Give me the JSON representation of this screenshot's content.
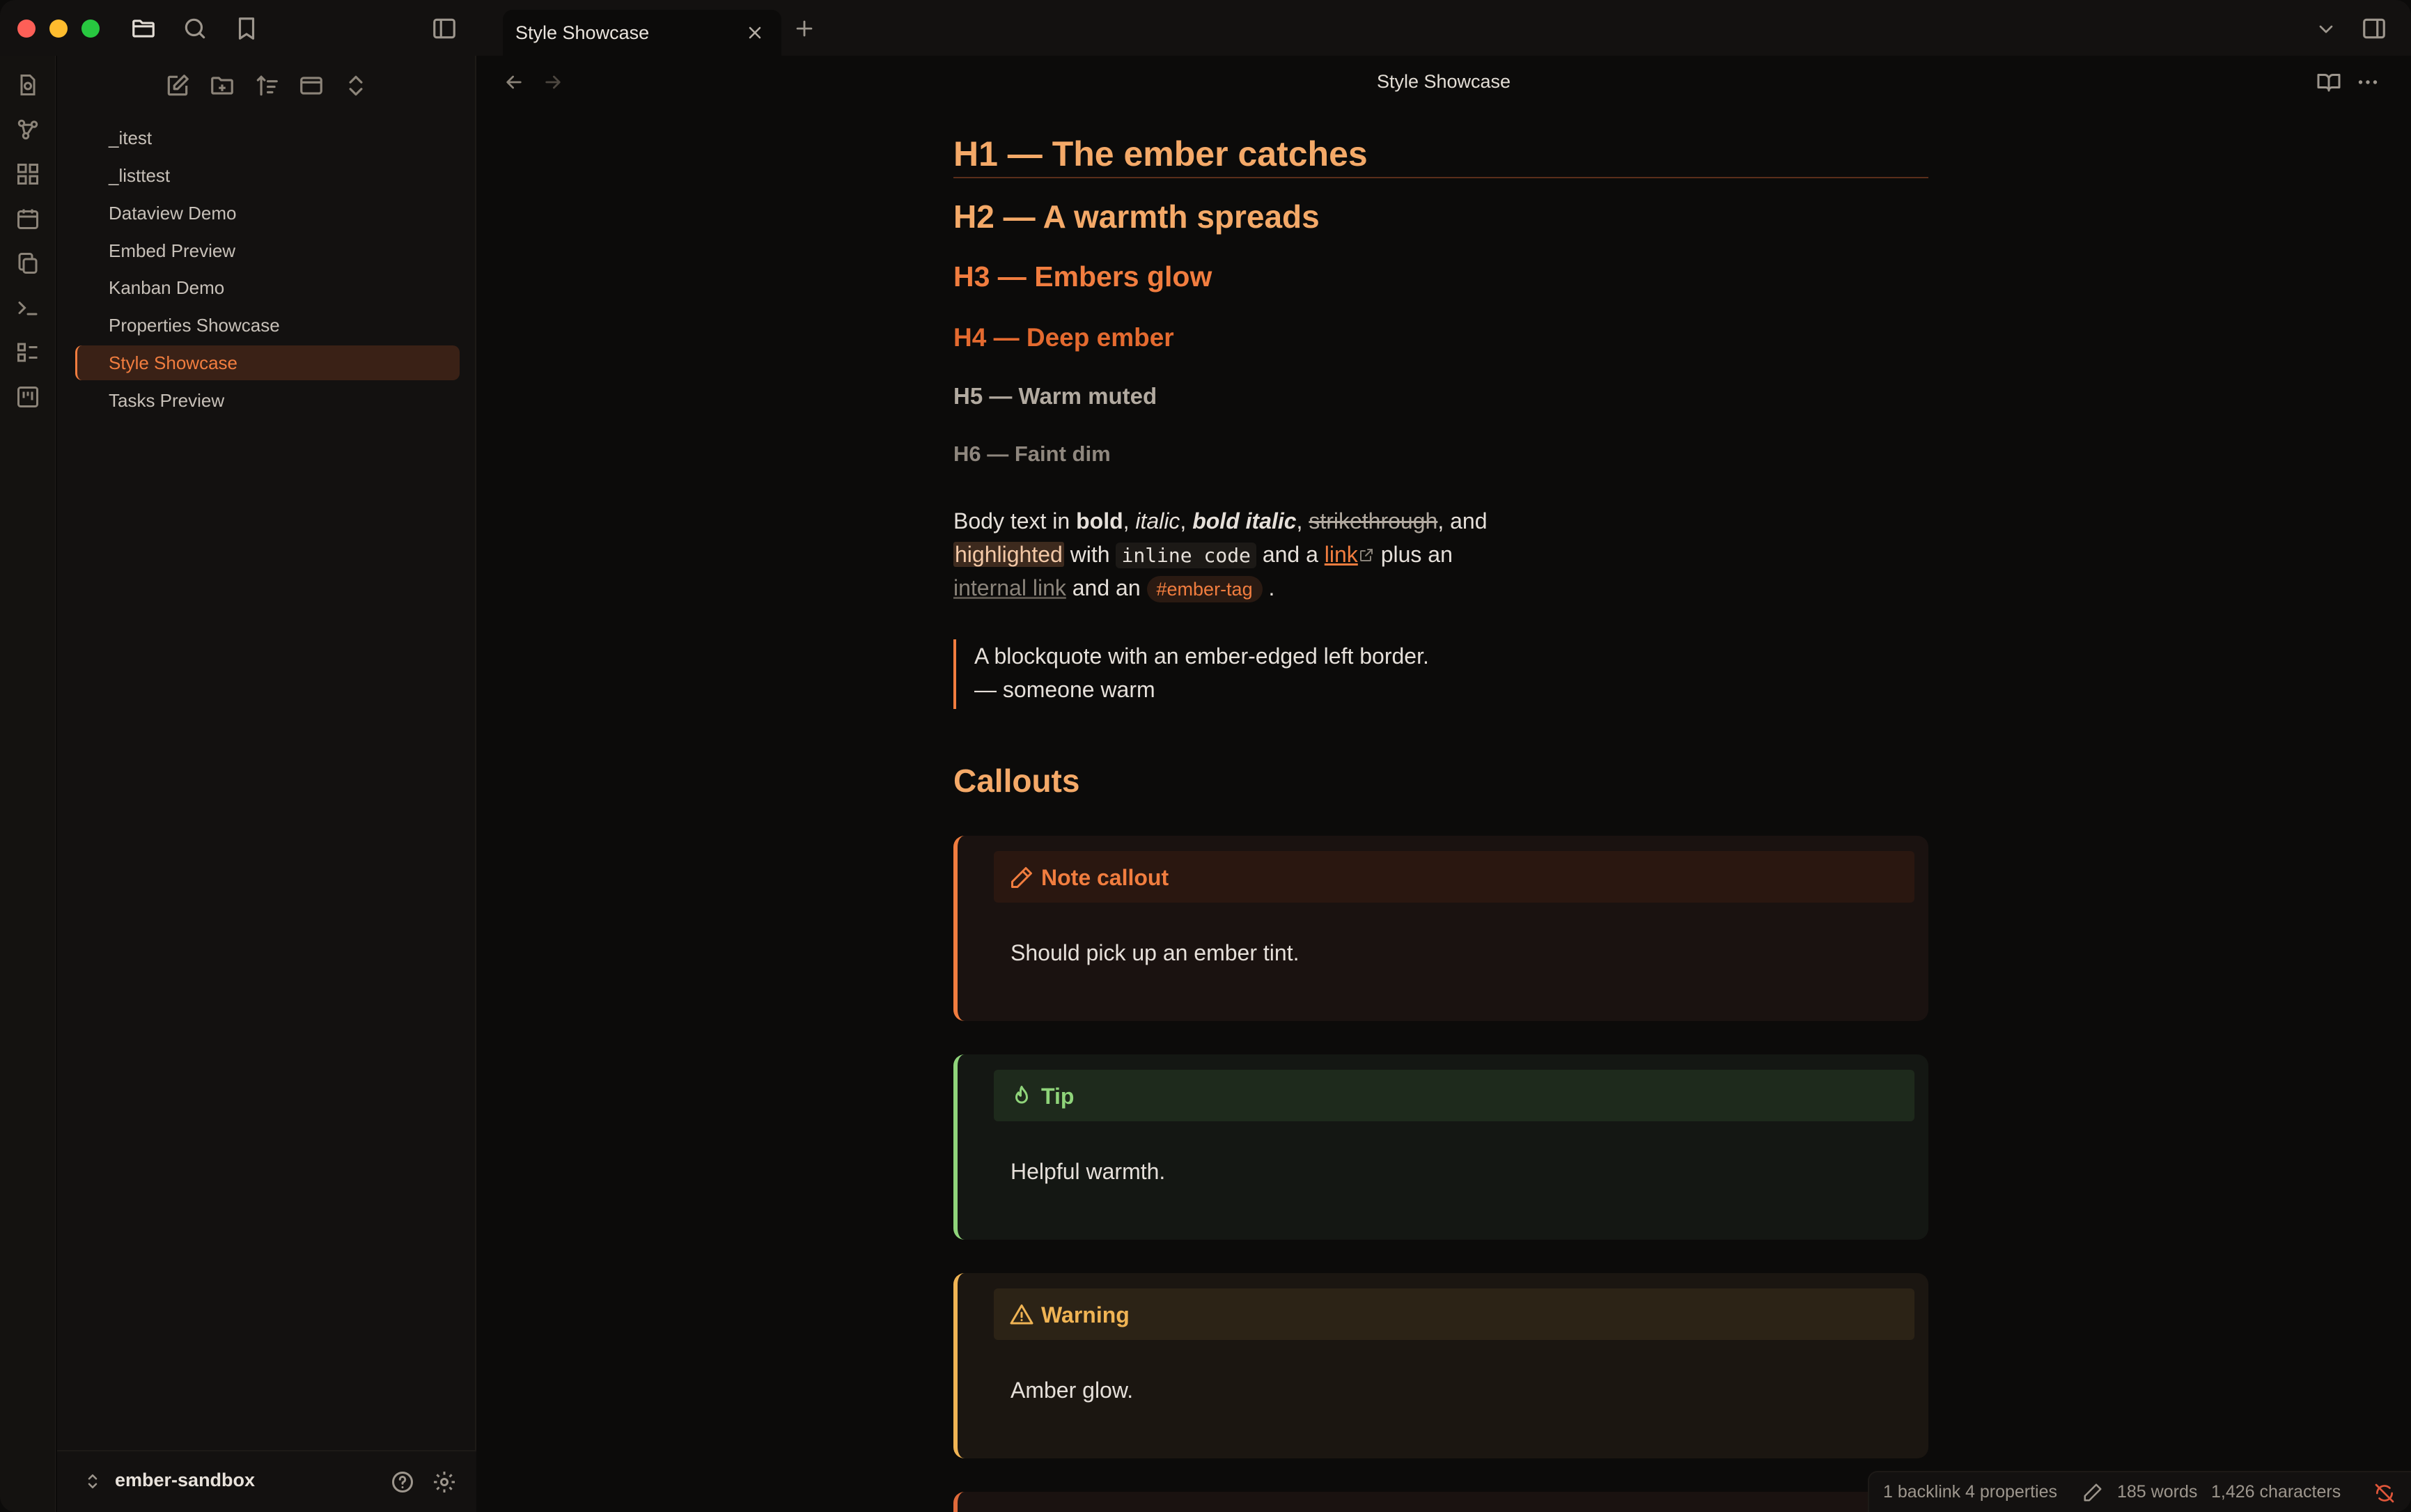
{
  "colors": {
    "accent": "#f17d3f",
    "h1": "#f4a968",
    "h2": "#f4a968",
    "h3": "#f17d3f",
    "h4": "#e46a2f",
    "h5": "#b2aaa0",
    "h6": "#8f877e",
    "tip": "#8fd47a",
    "warning": "#f0b454"
  },
  "sidebar": {
    "files": [
      "_itest",
      "_listtest",
      "Dataview Demo",
      "Embed Preview",
      "Kanban Demo",
      "Properties Showcase",
      "Style Showcase",
      "Tasks Preview"
    ],
    "active_file": "Style Showcase",
    "vault_name": "ember-sandbox"
  },
  "tab": {
    "title": "Style Showcase"
  },
  "view": {
    "title": "Style Showcase"
  },
  "content": {
    "h1": "H1 — The ember catches",
    "h2": "H2 — A warmth spreads",
    "h3": "H3 — Embers glow",
    "h4": "H4 — Deep ember",
    "h5": "H5 — Warm muted",
    "h6": "H6 — Faint dim",
    "body": {
      "prefix": "Body text in ",
      "bold": "bold",
      "comma1": ", ",
      "italic": "italic",
      "comma2": ", ",
      "bold_italic": "bold italic",
      "comma3": ", ",
      "strike": "strikethrough",
      "and1": ", and",
      "highlight": "highlighted",
      "with": " with ",
      "code": "inline code",
      "and_a": " and a ",
      "link": "link",
      "plus_an": " plus an",
      "internal_link": "internal link",
      "and_an": " and an ",
      "tag": "#ember-tag",
      "period": " ."
    },
    "blockquote": [
      "A blockquote with an ember-edged left border.",
      "— someone warm"
    ],
    "callouts_heading": "Callouts",
    "callouts": [
      {
        "title": "Note callout",
        "body": "Should pick up an ember tint.",
        "icon": "pencil-icon"
      },
      {
        "title": "Tip",
        "body": "Helpful warmth.",
        "icon": "flame-icon"
      },
      {
        "title": "Warning",
        "body": "Amber glow.",
        "icon": "alert-triangle-icon"
      }
    ]
  },
  "status": {
    "backlinks": "1 backlink",
    "properties": "4 properties",
    "words": "185 words",
    "characters": "1,426 characters"
  }
}
